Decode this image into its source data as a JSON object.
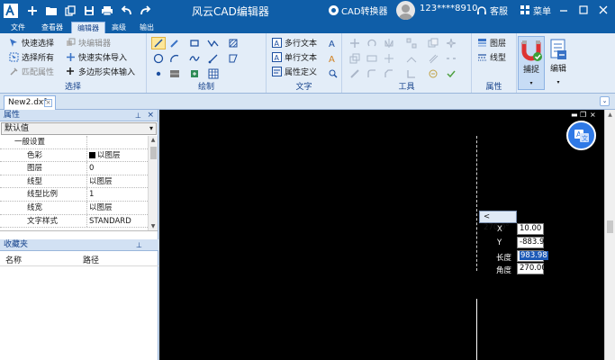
{
  "app": {
    "title": "风云CAD编辑器",
    "converter_label": "CAD转换器",
    "user": "123****8910",
    "service": "客服",
    "menu": "菜单"
  },
  "tabs": [
    {
      "label": "文件",
      "active": false
    },
    {
      "label": "查看器",
      "active": false
    },
    {
      "label": "编辑器",
      "active": true
    },
    {
      "label": "高级",
      "active": false
    },
    {
      "label": "输出",
      "active": false
    }
  ],
  "ribbon": {
    "select": {
      "label": "选择",
      "quick_select": "快速选择",
      "select_all": "选择所有",
      "match_props": "匹配属性",
      "block_editor": "块编辑器",
      "quick_entity_import": "快速实体导入",
      "polygon_entity_import": "多边形实体输入"
    },
    "draw": {
      "label": "绘制"
    },
    "text": {
      "label": "文字",
      "mtext": "多行文本",
      "stext": "单行文本",
      "attdef": "属性定义"
    },
    "tools": {
      "label": "工具"
    },
    "props": {
      "label": "属性",
      "layer": "图层",
      "linetype": "线型"
    },
    "snap": "捕捉",
    "edit": "编辑"
  },
  "doc_tab": {
    "name": "New2.dxf"
  },
  "properties_panel": {
    "title": "属性",
    "combo_value": "默认值",
    "category": "一般设置",
    "rows": [
      {
        "key": "色彩",
        "value": "以图层"
      },
      {
        "key": "图层",
        "value": "0"
      },
      {
        "key": "线型",
        "value": "以图层"
      },
      {
        "key": "线型比例",
        "value": "1"
      },
      {
        "key": "线宽",
        "value": "以图层"
      },
      {
        "key": "文字样式",
        "value": "STANDARD"
      }
    ]
  },
  "favorites_panel": {
    "title": "收藏夹",
    "col_name": "名称",
    "col_path": "路径"
  },
  "dynamic_input": {
    "angle_tip": "< 270.0°",
    "x_label": "X",
    "x_value": "10.00",
    "y_label": "Y",
    "y_value": "-883.98",
    "length_label": "长度",
    "length_value": "983.98",
    "angle_label": "角度",
    "angle_value": "270.00"
  },
  "colors": {
    "titlebar": "#0f5ea8",
    "ribbon_bg": "#e3edf8",
    "canvas": "#000000",
    "accent": "#2f79e6"
  }
}
